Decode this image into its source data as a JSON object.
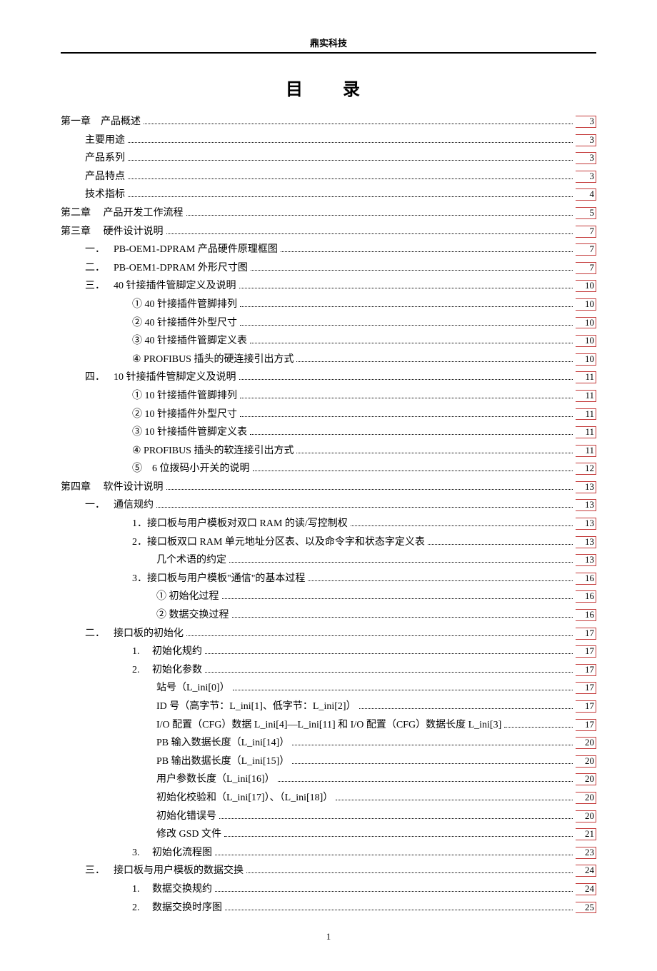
{
  "header": "鼎实科技",
  "title": "目　录",
  "footerPage": "1",
  "toc": [
    {
      "indent": 0,
      "label": "第一章　产品概述",
      "page": "3"
    },
    {
      "indent": 1,
      "label": "主要用途",
      "page": "3"
    },
    {
      "indent": 1,
      "label": "产品系列",
      "page": "3"
    },
    {
      "indent": 1,
      "label": "产品特点",
      "page": "3"
    },
    {
      "indent": 1,
      "label": "技术指标",
      "page": "4"
    },
    {
      "indent": 0,
      "label": "第二章　 产品开发工作流程",
      "page": "5"
    },
    {
      "indent": 0,
      "label": "第三章　 硬件设计说明",
      "page": "7"
    },
    {
      "indent": 2,
      "num": "一．",
      "label": "PB-OEM1-DPRAM 产品硬件原理框图",
      "page": "7"
    },
    {
      "indent": 2,
      "num": "二．",
      "label": "PB-OEM1-DPRAM 外形尺寸图",
      "page": "7"
    },
    {
      "indent": 2,
      "num": "三．",
      "label": "40 针接插件管脚定义及说明",
      "page": "10"
    },
    {
      "indent": 3,
      "label": "① 40 针接插件管脚排列",
      "page": "10"
    },
    {
      "indent": 3,
      "label": "② 40 针接插件外型尺寸",
      "page": "10"
    },
    {
      "indent": 3,
      "label": "③ 40 针接插件管脚定义表",
      "page": "10"
    },
    {
      "indent": 3,
      "label": "④ PROFIBUS 插头的硬连接引出方式",
      "page": "10"
    },
    {
      "indent": 2,
      "num": "四．",
      "label": "10 针接插件管脚定义及说明",
      "page": "11"
    },
    {
      "indent": 3,
      "label": "① 10 针接插件管脚排列",
      "page": "11"
    },
    {
      "indent": 3,
      "label": "② 10 针接插件外型尺寸",
      "page": "11"
    },
    {
      "indent": 3,
      "label": "③ 10 针接插件管脚定义表",
      "page": "11"
    },
    {
      "indent": 3,
      "label": "④ PROFIBUS 插头的软连接引出方式",
      "page": "11"
    },
    {
      "indent": 3,
      "label": "⑤　6 位拨码小开关的说明",
      "page": "12"
    },
    {
      "indent": 0,
      "label": "第四章　 软件设计说明",
      "page": "13"
    },
    {
      "indent": 2,
      "num": "一．",
      "label": "通信规约",
      "page": "13"
    },
    {
      "indent": 4,
      "label": "1．接口板与用户模板对双口 RAM 的读/写控制权",
      "page": "13"
    },
    {
      "indent": 4,
      "label": "2．接口板双口 RAM 单元地址分区表、以及命令字和状态字定义表",
      "page": "13"
    },
    {
      "indent": 5,
      "label": "几个术语的约定",
      "page": "13"
    },
    {
      "indent": 4,
      "label": "3．接口板与用户模板\"通信\"的基本过程",
      "page": "16"
    },
    {
      "indent": 5,
      "label": "① 初始化过程",
      "page": "16"
    },
    {
      "indent": 5,
      "label": "② 数据交换过程",
      "page": "16"
    },
    {
      "indent": 2,
      "num": "二．",
      "label": "接口板的初始化",
      "page": "17"
    },
    {
      "indent": 4,
      "label": "1.　 初始化规约",
      "page": "17"
    },
    {
      "indent": 4,
      "label": "2.　 初始化参数",
      "page": "17"
    },
    {
      "indent": 5,
      "label": "站号（L_ini[0]）",
      "page": "17"
    },
    {
      "indent": 5,
      "label": "ID 号（高字节：L_ini[1]、低字节：L_ini[2]）",
      "page": "17"
    },
    {
      "indent": 5,
      "label": "I/O 配置（CFG）数据 L_ini[4]—L_ini[11]  和 I/O 配置（CFG）数据长度 L_ini[3]",
      "page": "17"
    },
    {
      "indent": 5,
      "label": "PB 输入数据长度（L_ini[14]）",
      "page": "20"
    },
    {
      "indent": 5,
      "label": "PB 输出数据长度（L_ini[15]）",
      "page": "20"
    },
    {
      "indent": 5,
      "label": "用户参数长度（L_ini[16]）",
      "page": "20"
    },
    {
      "indent": 5,
      "label": "初始化校验和（L_ini[17]）、（L_ini[18]）",
      "page": "20"
    },
    {
      "indent": 5,
      "label": "初始化错误号",
      "page": "20"
    },
    {
      "indent": 5,
      "label": "修改 GSD 文件",
      "page": "21"
    },
    {
      "indent": 4,
      "label": "3.　 初始化流程图",
      "page": "23"
    },
    {
      "indent": 2,
      "num": "三．",
      "label": "接口板与用户模板的数据交换",
      "page": "24"
    },
    {
      "indent": 4,
      "label": "1.　 数据交换规约",
      "page": "24"
    },
    {
      "indent": 4,
      "label": "2.　 数据交换时序图",
      "page": "25"
    }
  ]
}
